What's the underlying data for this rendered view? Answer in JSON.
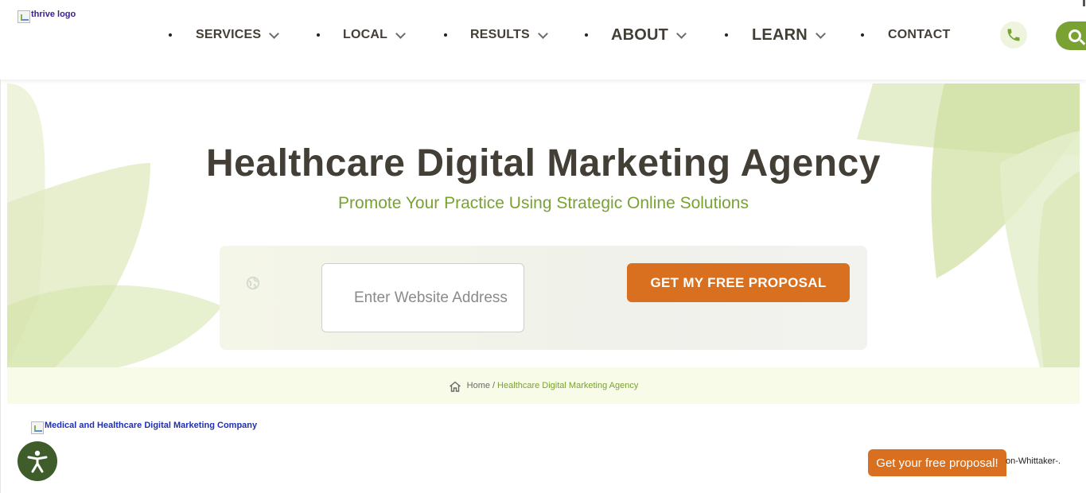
{
  "header": {
    "logo_alt": "thrive logo",
    "nav": [
      {
        "label": "SERVICES",
        "has_dropdown": true
      },
      {
        "label": "LOCAL",
        "has_dropdown": true
      },
      {
        "label": "RESULTS",
        "has_dropdown": true
      },
      {
        "label": "ABOUT",
        "has_dropdown": true
      },
      {
        "label": "LEARN",
        "has_dropdown": true
      },
      {
        "label": "CONTACT",
        "has_dropdown": false
      }
    ],
    "phone_icon": "phone-icon",
    "search_icon": "search-icon"
  },
  "hero": {
    "title": "Healthcare Digital Marketing Agency",
    "subtitle": "Promote Your Practice Using Strategic Online Solutions",
    "url_placeholder": "Enter Website Address",
    "cta_label": "GET MY FREE PROPOSAL"
  },
  "breadcrumb": {
    "home": "Home",
    "separator": "/",
    "current": "Healthcare Digital Marketing Agency"
  },
  "content": {
    "image_alt": "Medical and Healthcare Digital Marketing Company"
  },
  "floating": {
    "proposal_label": "Get your free proposal!",
    "stray_text": "on-Whittaker-."
  },
  "colors": {
    "accent_green": "#79a232",
    "cta_orange": "#d9701f",
    "heading": "#433f36",
    "a11y_green": "#3e5d2a"
  }
}
